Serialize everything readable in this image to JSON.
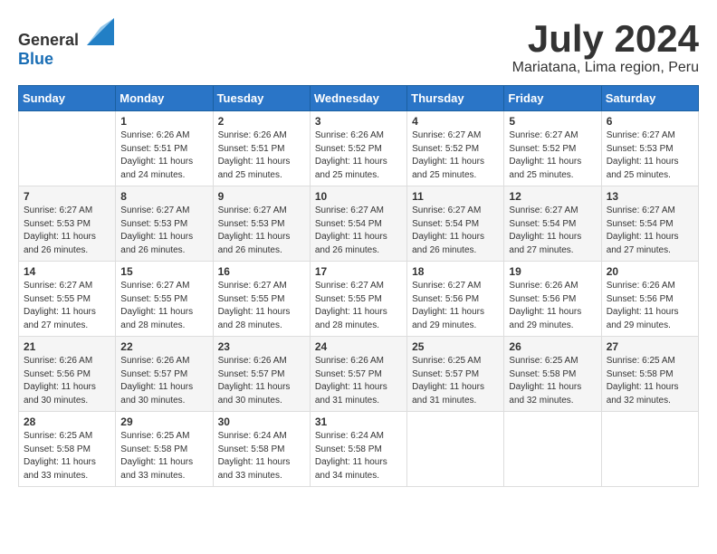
{
  "header": {
    "logo_general": "General",
    "logo_blue": "Blue",
    "month_title": "July 2024",
    "location": "Mariatana, Lima region, Peru"
  },
  "weekdays": [
    "Sunday",
    "Monday",
    "Tuesday",
    "Wednesday",
    "Thursday",
    "Friday",
    "Saturday"
  ],
  "weeks": [
    [
      {
        "day": "",
        "sunrise": "",
        "sunset": "",
        "daylight": ""
      },
      {
        "day": "1",
        "sunrise": "Sunrise: 6:26 AM",
        "sunset": "Sunset: 5:51 PM",
        "daylight": "Daylight: 11 hours and 24 minutes."
      },
      {
        "day": "2",
        "sunrise": "Sunrise: 6:26 AM",
        "sunset": "Sunset: 5:51 PM",
        "daylight": "Daylight: 11 hours and 25 minutes."
      },
      {
        "day": "3",
        "sunrise": "Sunrise: 6:26 AM",
        "sunset": "Sunset: 5:52 PM",
        "daylight": "Daylight: 11 hours and 25 minutes."
      },
      {
        "day": "4",
        "sunrise": "Sunrise: 6:27 AM",
        "sunset": "Sunset: 5:52 PM",
        "daylight": "Daylight: 11 hours and 25 minutes."
      },
      {
        "day": "5",
        "sunrise": "Sunrise: 6:27 AM",
        "sunset": "Sunset: 5:52 PM",
        "daylight": "Daylight: 11 hours and 25 minutes."
      },
      {
        "day": "6",
        "sunrise": "Sunrise: 6:27 AM",
        "sunset": "Sunset: 5:53 PM",
        "daylight": "Daylight: 11 hours and 25 minutes."
      }
    ],
    [
      {
        "day": "7",
        "sunrise": "Sunrise: 6:27 AM",
        "sunset": "Sunset: 5:53 PM",
        "daylight": "Daylight: 11 hours and 26 minutes."
      },
      {
        "day": "8",
        "sunrise": "Sunrise: 6:27 AM",
        "sunset": "Sunset: 5:53 PM",
        "daylight": "Daylight: 11 hours and 26 minutes."
      },
      {
        "day": "9",
        "sunrise": "Sunrise: 6:27 AM",
        "sunset": "Sunset: 5:53 PM",
        "daylight": "Daylight: 11 hours and 26 minutes."
      },
      {
        "day": "10",
        "sunrise": "Sunrise: 6:27 AM",
        "sunset": "Sunset: 5:54 PM",
        "daylight": "Daylight: 11 hours and 26 minutes."
      },
      {
        "day": "11",
        "sunrise": "Sunrise: 6:27 AM",
        "sunset": "Sunset: 5:54 PM",
        "daylight": "Daylight: 11 hours and 26 minutes."
      },
      {
        "day": "12",
        "sunrise": "Sunrise: 6:27 AM",
        "sunset": "Sunset: 5:54 PM",
        "daylight": "Daylight: 11 hours and 27 minutes."
      },
      {
        "day": "13",
        "sunrise": "Sunrise: 6:27 AM",
        "sunset": "Sunset: 5:54 PM",
        "daylight": "Daylight: 11 hours and 27 minutes."
      }
    ],
    [
      {
        "day": "14",
        "sunrise": "Sunrise: 6:27 AM",
        "sunset": "Sunset: 5:55 PM",
        "daylight": "Daylight: 11 hours and 27 minutes."
      },
      {
        "day": "15",
        "sunrise": "Sunrise: 6:27 AM",
        "sunset": "Sunset: 5:55 PM",
        "daylight": "Daylight: 11 hours and 28 minutes."
      },
      {
        "day": "16",
        "sunrise": "Sunrise: 6:27 AM",
        "sunset": "Sunset: 5:55 PM",
        "daylight": "Daylight: 11 hours and 28 minutes."
      },
      {
        "day": "17",
        "sunrise": "Sunrise: 6:27 AM",
        "sunset": "Sunset: 5:55 PM",
        "daylight": "Daylight: 11 hours and 28 minutes."
      },
      {
        "day": "18",
        "sunrise": "Sunrise: 6:27 AM",
        "sunset": "Sunset: 5:56 PM",
        "daylight": "Daylight: 11 hours and 29 minutes."
      },
      {
        "day": "19",
        "sunrise": "Sunrise: 6:26 AM",
        "sunset": "Sunset: 5:56 PM",
        "daylight": "Daylight: 11 hours and 29 minutes."
      },
      {
        "day": "20",
        "sunrise": "Sunrise: 6:26 AM",
        "sunset": "Sunset: 5:56 PM",
        "daylight": "Daylight: 11 hours and 29 minutes."
      }
    ],
    [
      {
        "day": "21",
        "sunrise": "Sunrise: 6:26 AM",
        "sunset": "Sunset: 5:56 PM",
        "daylight": "Daylight: 11 hours and 30 minutes."
      },
      {
        "day": "22",
        "sunrise": "Sunrise: 6:26 AM",
        "sunset": "Sunset: 5:57 PM",
        "daylight": "Daylight: 11 hours and 30 minutes."
      },
      {
        "day": "23",
        "sunrise": "Sunrise: 6:26 AM",
        "sunset": "Sunset: 5:57 PM",
        "daylight": "Daylight: 11 hours and 30 minutes."
      },
      {
        "day": "24",
        "sunrise": "Sunrise: 6:26 AM",
        "sunset": "Sunset: 5:57 PM",
        "daylight": "Daylight: 11 hours and 31 minutes."
      },
      {
        "day": "25",
        "sunrise": "Sunrise: 6:25 AM",
        "sunset": "Sunset: 5:57 PM",
        "daylight": "Daylight: 11 hours and 31 minutes."
      },
      {
        "day": "26",
        "sunrise": "Sunrise: 6:25 AM",
        "sunset": "Sunset: 5:58 PM",
        "daylight": "Daylight: 11 hours and 32 minutes."
      },
      {
        "day": "27",
        "sunrise": "Sunrise: 6:25 AM",
        "sunset": "Sunset: 5:58 PM",
        "daylight": "Daylight: 11 hours and 32 minutes."
      }
    ],
    [
      {
        "day": "28",
        "sunrise": "Sunrise: 6:25 AM",
        "sunset": "Sunset: 5:58 PM",
        "daylight": "Daylight: 11 hours and 33 minutes."
      },
      {
        "day": "29",
        "sunrise": "Sunrise: 6:25 AM",
        "sunset": "Sunset: 5:58 PM",
        "daylight": "Daylight: 11 hours and 33 minutes."
      },
      {
        "day": "30",
        "sunrise": "Sunrise: 6:24 AM",
        "sunset": "Sunset: 5:58 PM",
        "daylight": "Daylight: 11 hours and 33 minutes."
      },
      {
        "day": "31",
        "sunrise": "Sunrise: 6:24 AM",
        "sunset": "Sunset: 5:58 PM",
        "daylight": "Daylight: 11 hours and 34 minutes."
      },
      {
        "day": "",
        "sunrise": "",
        "sunset": "",
        "daylight": ""
      },
      {
        "day": "",
        "sunrise": "",
        "sunset": "",
        "daylight": ""
      },
      {
        "day": "",
        "sunrise": "",
        "sunset": "",
        "daylight": ""
      }
    ]
  ]
}
